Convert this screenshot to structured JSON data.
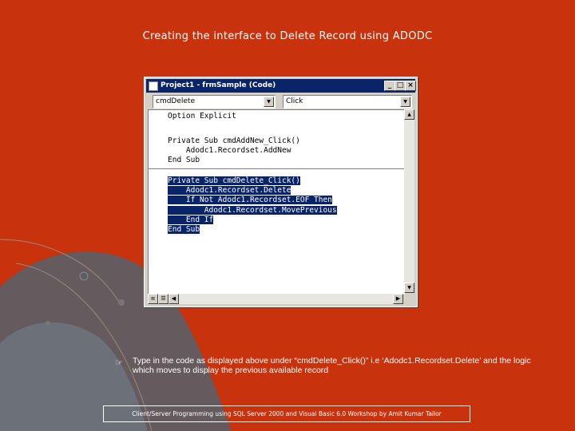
{
  "slide": {
    "title": "Creating the interface to Delete Record using ADODC",
    "bullet_text": "Type in the code as displayed above under “cmdDelete_Click()” i.e ‘Adodc1.Recordset.Delete’ and the logic which moves to display the previous available record",
    "footer": "Client/Server Programming using SQL Server 2000 and Visual Basic 6.0 Workshop by Amit Kumar Tailor"
  },
  "window": {
    "title": "Project1 - frmSample (Code)",
    "object_combo": "cmdDelete",
    "procedure_combo": "Click"
  },
  "code": {
    "option": "Option Explicit",
    "block1": [
      "Private Sub cmdAddNew_Click()",
      "    Adodc1.Recordset.AddNew",
      "End Sub"
    ],
    "block2": [
      "Private Sub cmdDelete_Click()",
      "    Adodc1.Recordset.Delete",
      "    If Not Adodc1.Recordset.EOF Then",
      "        Adodc1.Recordset.MovePrevious",
      "    End If",
      "End Sub"
    ]
  },
  "colors": {
    "background": "#c8320c",
    "titlebar": "#0a246a",
    "selection": "#0a246a"
  },
  "icons": {
    "bullet": "hand-pointer-icon"
  }
}
